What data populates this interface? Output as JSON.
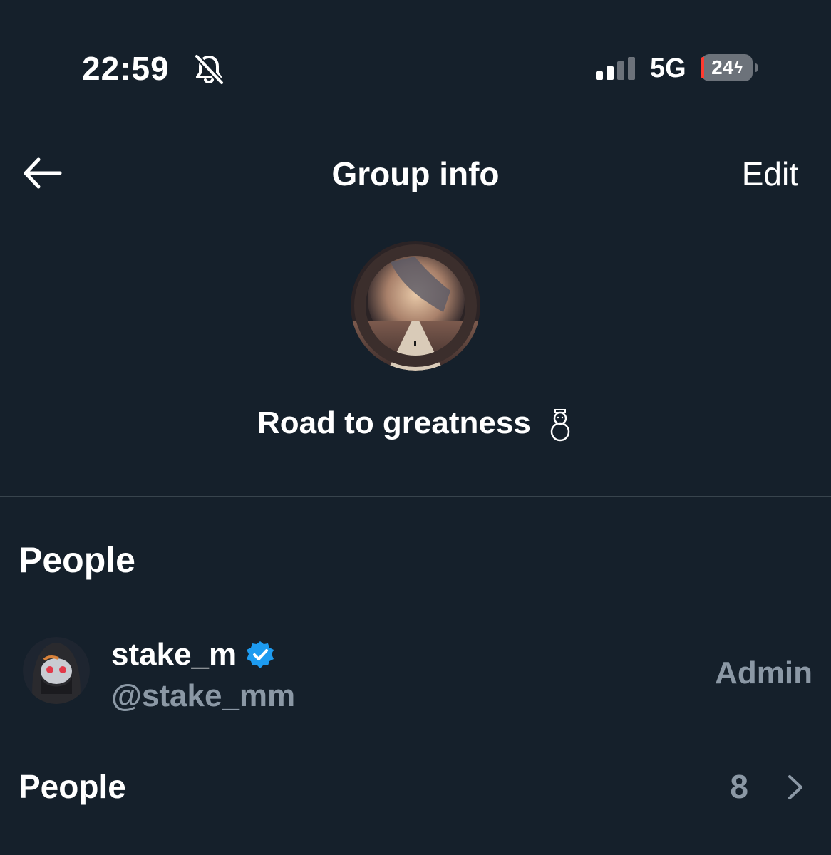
{
  "status_bar": {
    "time": "22:59",
    "network": "5G",
    "battery": "24"
  },
  "header": {
    "title": "Group info",
    "edit_label": "Edit"
  },
  "group": {
    "name": "Road to greatness"
  },
  "people_section": {
    "title": "People",
    "members": [
      {
        "display_name": "stake_m",
        "handle": "@stake_mm",
        "role": "Admin",
        "verified": true
      }
    ],
    "people_row_label": "People",
    "people_count": "8"
  },
  "icons": {
    "back": "arrow-left-icon",
    "mute": "bell-slash-icon",
    "signal": "signal-bars-icon",
    "verified": "verified-badge-icon",
    "snowman": "snowman-icon",
    "chevron": "chevron-right-icon"
  },
  "colors": {
    "background": "#15202b",
    "text_primary": "#ffffff",
    "text_secondary": "#8b98a5",
    "verified_blue": "#1d9bf0",
    "divider": "#38444d"
  }
}
